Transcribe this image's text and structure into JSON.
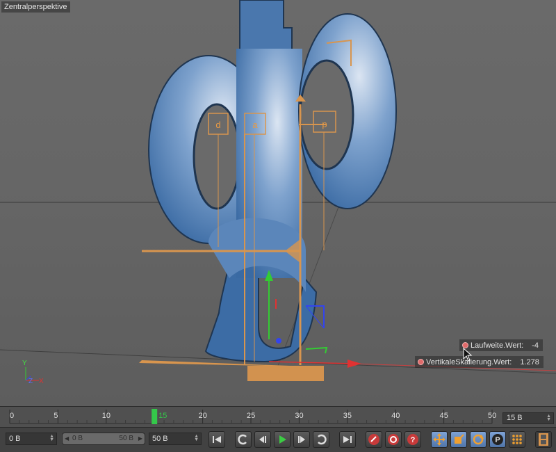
{
  "viewport": {
    "title": "Zentralperspektive",
    "axis_labels": {
      "y": "Y",
      "z": "Z",
      "x": "X"
    },
    "letter_handles": [
      "d",
      "a",
      "p"
    ],
    "colors": {
      "object_blue": "#4f7fb5",
      "object_highlight": "#d8e3f0",
      "handle_orange": "#d8954e",
      "axis_x": "#e03232",
      "axis_y": "#33cc33",
      "axis_z": "#3344ee"
    },
    "tags": [
      {
        "label": "Laufweite.Wert:",
        "value": "-4"
      },
      {
        "label": "VertikaleSkalierung.Wert:",
        "value": "1.278"
      }
    ]
  },
  "timeline": {
    "ticks": [
      "0",
      "5",
      "10",
      "15",
      "20",
      "25",
      "30",
      "35",
      "40",
      "45",
      "50"
    ],
    "current_frame_label": "15",
    "current_frame": 15,
    "max_frame": 50,
    "frame_field": "15 B",
    "playhead_color": "#34c84a"
  },
  "toolbar": {
    "start_field": "0 B",
    "range_start": "0 B",
    "range_end": "50 B",
    "end_field": "50 B",
    "buttons": [
      {
        "name": "go-to-start-button",
        "icon": "skip-start-icon"
      },
      {
        "name": "previous-key-button",
        "icon": "previous-key-icon"
      },
      {
        "name": "previous-frame-button",
        "icon": "previous-frame-icon"
      },
      {
        "name": "play-button",
        "icon": "play-icon"
      },
      {
        "name": "next-frame-button",
        "icon": "next-frame-icon"
      },
      {
        "name": "next-key-button",
        "icon": "next-key-icon"
      },
      {
        "name": "go-to-end-button",
        "icon": "skip-end-icon"
      },
      {
        "name": "record-button",
        "icon": "record-icon"
      },
      {
        "name": "autokey-button",
        "icon": "autokey-icon"
      },
      {
        "name": "keyframe-selection-button",
        "icon": "keyframe-selection-icon"
      },
      {
        "name": "record-position-button",
        "icon": "move-icon"
      },
      {
        "name": "record-scale-button",
        "icon": "scale-icon"
      },
      {
        "name": "record-rotation-button",
        "icon": "rotate-icon"
      },
      {
        "name": "record-parameter-button",
        "icon": "parameter-icon"
      },
      {
        "name": "point-level-button",
        "icon": "points-icon"
      },
      {
        "name": "timeline-button",
        "icon": "film-icon"
      }
    ]
  }
}
